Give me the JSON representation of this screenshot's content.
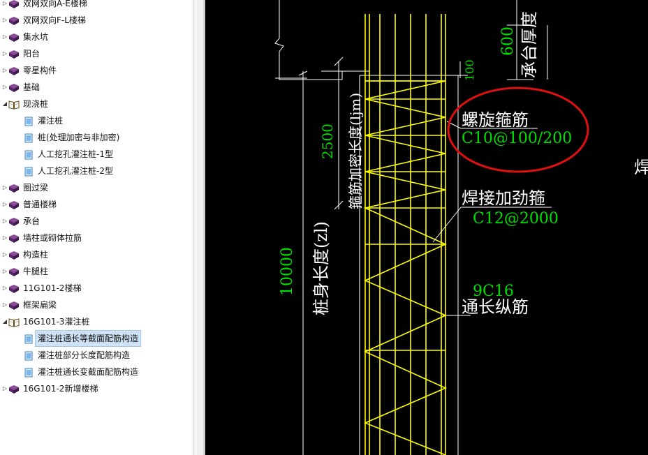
{
  "tree": {
    "items": [
      {
        "label": "双网双向A-E楼梯",
        "kind": "book",
        "level": 0
      },
      {
        "label": "双网双向F-L楼梯",
        "kind": "book",
        "level": 0
      },
      {
        "label": "集水坑",
        "kind": "book",
        "level": 0
      },
      {
        "label": "阳台",
        "kind": "book",
        "level": 0
      },
      {
        "label": "零星构件",
        "kind": "book",
        "level": 0
      },
      {
        "label": "基础",
        "kind": "book",
        "level": 0
      },
      {
        "label": "现浇桩",
        "kind": "open-book",
        "level": 0
      },
      {
        "label": "灌注桩",
        "kind": "page",
        "level": 1
      },
      {
        "label": "桩(处理加密与非加密)",
        "kind": "page",
        "level": 1
      },
      {
        "label": "人工挖孔灌注桩-1型",
        "kind": "page",
        "level": 1
      },
      {
        "label": "人工挖孔灌注桩-2型",
        "kind": "page",
        "level": 1
      },
      {
        "label": "圈过梁",
        "kind": "book",
        "level": 0
      },
      {
        "label": "普通楼梯",
        "kind": "book",
        "level": 0
      },
      {
        "label": "承台",
        "kind": "book",
        "level": 0
      },
      {
        "label": "墙柱或砌体拉筋",
        "kind": "book",
        "level": 0
      },
      {
        "label": "构造柱",
        "kind": "book",
        "level": 0
      },
      {
        "label": "牛腿柱",
        "kind": "book",
        "level": 0
      },
      {
        "label": "11G101-2楼梯",
        "kind": "book",
        "level": 0
      },
      {
        "label": "框架扁梁",
        "kind": "book",
        "level": 0
      },
      {
        "label": "16G101-3灌注桩",
        "kind": "open-book",
        "level": 0
      },
      {
        "label": "灌注桩通长等截面配筋构造",
        "kind": "page",
        "level": 1,
        "selected": true
      },
      {
        "label": "灌注桩部分长度配筋构造",
        "kind": "page",
        "level": 1
      },
      {
        "label": "灌注桩通长变截面配筋构造",
        "kind": "page",
        "level": 1
      },
      {
        "label": "16G101-2新增楼梯",
        "kind": "book",
        "level": 0
      }
    ]
  },
  "drawing": {
    "dim_600": "600",
    "cap_thickness": "承台厚度",
    "dim_100": "100",
    "dim_2500": "2500",
    "dense_length": "箍筋加密长度(ljm)",
    "pile_body_length": "桩身长度(zl)",
    "dim_10000": "10000",
    "spiral_stirrup": "螺旋箍筋",
    "spiral_spec": "C10@100/200",
    "weld_stirrup": "焊接加劲箍",
    "weld_spec": "C12@2000",
    "long_bar_spec": "9C16",
    "long_bar": "通长纵筋",
    "cut_char": "焊"
  },
  "colors": {
    "rebar": "#ffff00",
    "dim_text": "#00e000",
    "line": "#ffffff",
    "highlight_circle": "#e01010",
    "book_icon": "#6b2f7a",
    "selected_bg": "#cfe3f7"
  }
}
